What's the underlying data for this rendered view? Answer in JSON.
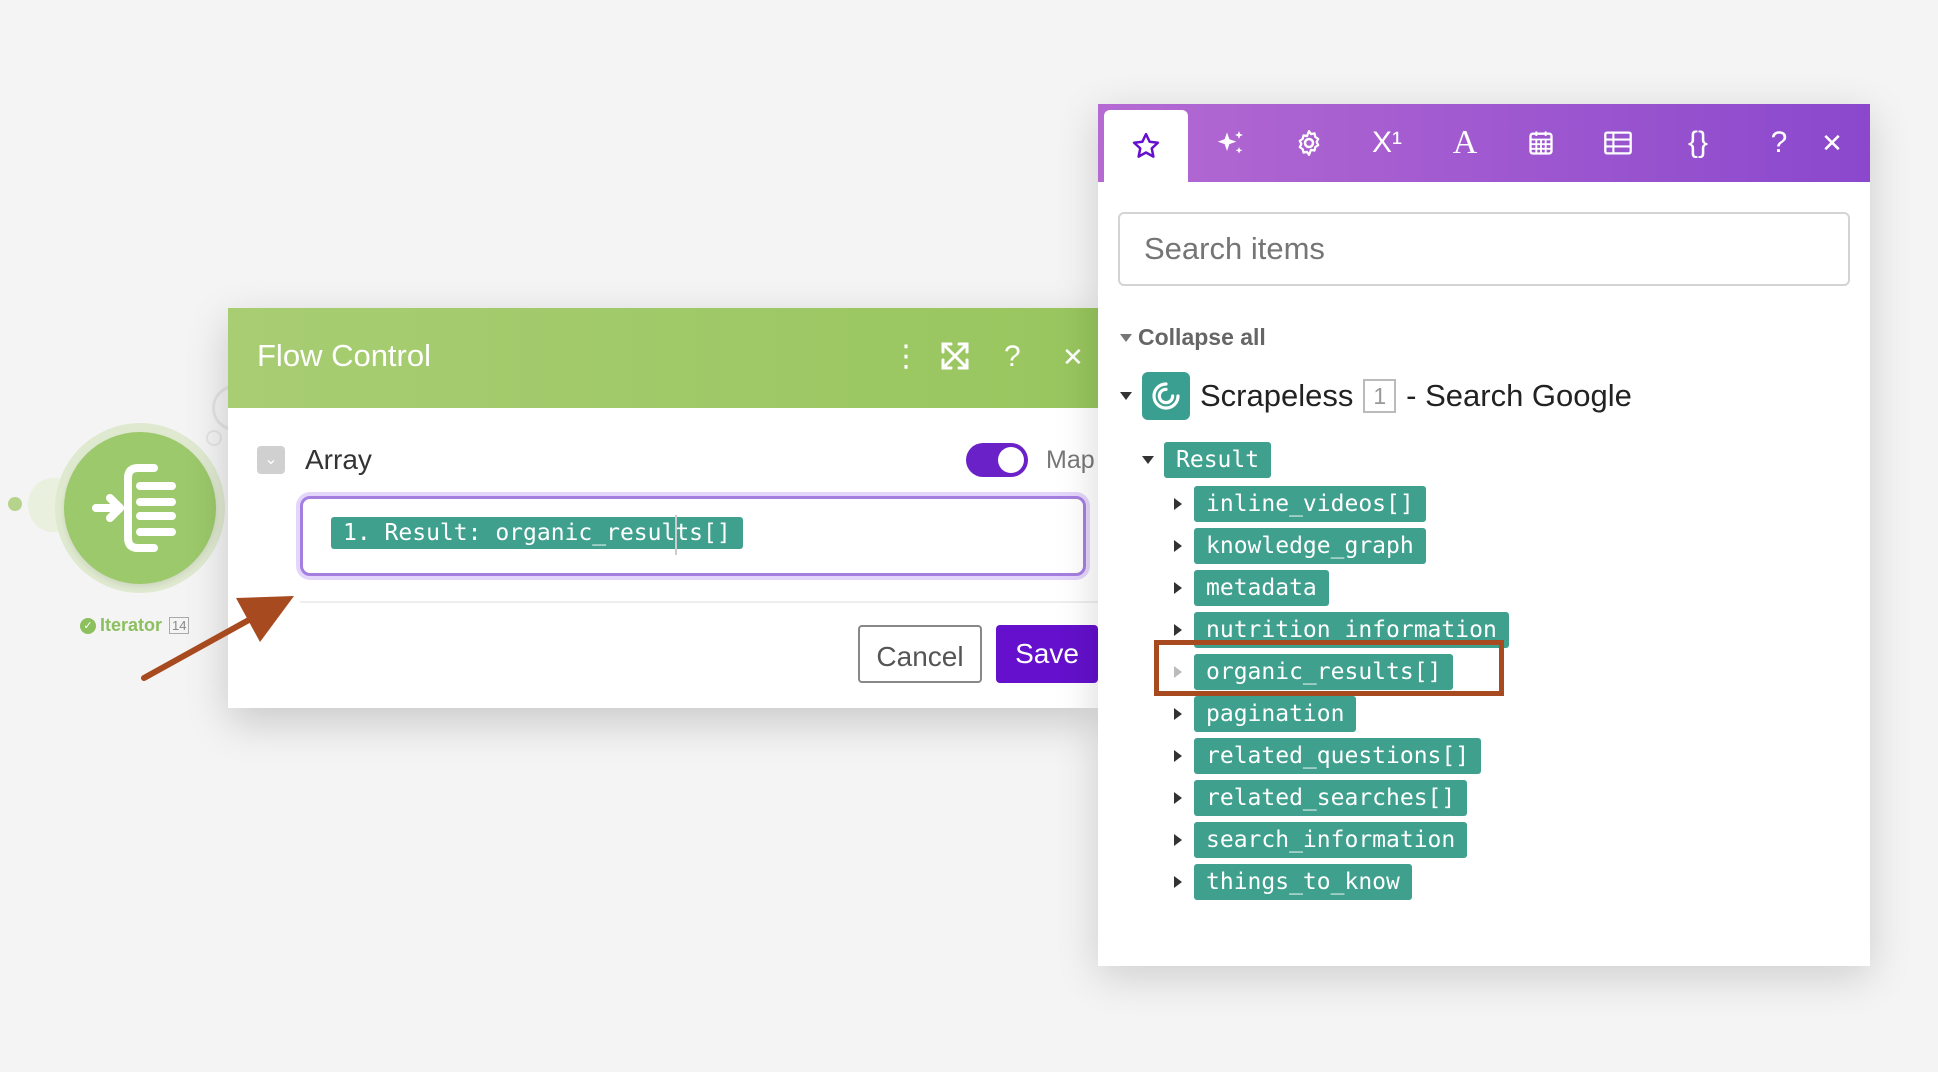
{
  "iterator": {
    "label": "Iterator",
    "count": "14"
  },
  "flow_control": {
    "title": "Flow Control",
    "array_label": "Array",
    "map_label": "Map",
    "map_enabled": true,
    "input_pill": "1. Result: organic_results[]",
    "cancel_label": "Cancel",
    "save_label": "Save"
  },
  "mapping_panel": {
    "tabs": [
      "star-icon",
      "sparkles-icon",
      "gear-icon",
      "superscript-icon",
      "text-icon",
      "calendar-icon",
      "table-icon",
      "braces-icon",
      "help-icon",
      "close-icon"
    ],
    "tab_labels": {
      "superscript": "X¹",
      "text": "A",
      "braces": "{}",
      "help": "?",
      "close": "✕"
    },
    "search_placeholder": "Search items",
    "collapse_all": "Collapse all",
    "module": {
      "name": "Scrapeless",
      "number": "1",
      "suffix": "- Search Google"
    },
    "result_label": "Result",
    "items": [
      "inline_videos[]",
      "knowledge_graph",
      "metadata",
      "nutrition_information",
      "organic_results[]",
      "pagination",
      "related_questions[]",
      "related_searches[]",
      "search_information",
      "things_to_know"
    ]
  },
  "colors": {
    "flow_header": "#a0ca67",
    "tag": "#3fa08e",
    "save": "#6410cc",
    "panel_header": "#9c56cf",
    "annotation": "#a84a1f"
  }
}
